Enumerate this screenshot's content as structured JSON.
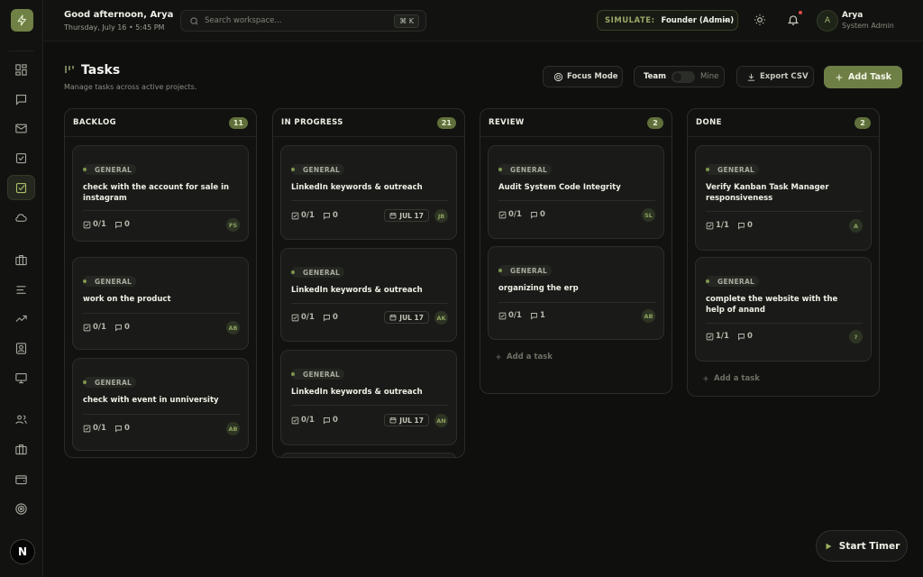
{
  "header": {
    "greeting": "Good afternoon, Arya",
    "datetime": "Thursday, July 16 • 5:45 PM",
    "search_placeholder": "Search workspace...",
    "search_shortcut": "⌘ K",
    "simulate_label": "SIMULATE:",
    "simulate_role": "Founder (Admin)",
    "user_initial": "A",
    "user_name": "Arya",
    "user_role": "System Admin"
  },
  "sidebar": {
    "logo_icon": "bolt-icon",
    "items": [
      {
        "icon": "dashboard-icon",
        "active": false
      },
      {
        "icon": "chat-icon",
        "active": false
      },
      {
        "icon": "mail-icon",
        "active": false
      },
      {
        "icon": "checkbox-icon",
        "active": false
      },
      {
        "icon": "tasks-icon",
        "active": true
      },
      {
        "icon": "cloud-icon",
        "active": false
      },
      {
        "icon": "briefcase-icon",
        "active": false
      },
      {
        "icon": "list-icon",
        "active": false
      },
      {
        "icon": "trending-icon",
        "active": false
      },
      {
        "icon": "contact-icon",
        "active": false
      },
      {
        "icon": "monitor-icon",
        "active": false
      },
      {
        "icon": "users-icon",
        "active": false
      },
      {
        "icon": "briefcase-icon",
        "active": false
      },
      {
        "icon": "wallet-icon",
        "active": false
      },
      {
        "icon": "target-icon",
        "active": false
      }
    ],
    "bottom_avatar": "N"
  },
  "page": {
    "title": "Tasks",
    "subtitle": "Manage tasks across active projects.",
    "focus_mode_label": "Focus Mode",
    "team_label": "Team",
    "mine_label": "Mine",
    "export_label": "Export CSV",
    "add_task_label": "Add Task"
  },
  "columns": [
    {
      "title": "BACKLOG",
      "count": "11",
      "cards": [
        {
          "tag": "GENERAL",
          "title": "check with the account for sale in instagram",
          "subtasks": "0/1",
          "comments": "0",
          "due": "",
          "assignee": "FS"
        },
        {
          "tag": "GENERAL",
          "title": "work on the product",
          "subtasks": "0/1",
          "comments": "0",
          "due": "",
          "assignee": "AB"
        },
        {
          "tag": "GENERAL",
          "title": "check with event in unniversity",
          "subtasks": "0/1",
          "comments": "0",
          "due": "",
          "assignee": "AB"
        }
      ],
      "add_task": ""
    },
    {
      "title": "IN PROGRESS",
      "count": "21",
      "cards": [
        {
          "tag": "GENERAL",
          "title": "LinkedIn keywords & outreach",
          "subtasks": "0/1",
          "comments": "0",
          "due": "JUL 17",
          "assignee": "JB"
        },
        {
          "tag": "GENERAL",
          "title": "LinkedIn keywords & outreach",
          "subtasks": "0/1",
          "comments": "0",
          "due": "JUL 17",
          "assignee": "AK"
        },
        {
          "tag": "GENERAL",
          "title": "LinkedIn keywords & outreach",
          "subtasks": "0/1",
          "comments": "0",
          "due": "JUL 17",
          "assignee": "AN"
        }
      ],
      "add_task": ""
    },
    {
      "title": "REVIEW",
      "count": "2",
      "cards": [
        {
          "tag": "GENERAL",
          "title": "Audit System Code Integrity",
          "subtasks": "0/1",
          "comments": "0",
          "due": "",
          "assignee": "SL"
        },
        {
          "tag": "GENERAL",
          "title": "organizing the erp",
          "subtasks": "0/1",
          "comments": "1",
          "due": "",
          "assignee": "AB"
        }
      ],
      "add_task": "Add a task"
    },
    {
      "title": "DONE",
      "count": "2",
      "cards": [
        {
          "tag": "GENERAL",
          "title": "Verify Kanban Task Manager responsiveness",
          "subtasks": "1/1",
          "comments": "0",
          "due": "",
          "assignee": "A"
        },
        {
          "tag": "GENERAL",
          "title": "complete the website with the help of anand",
          "subtasks": "1/1",
          "comments": "0",
          "due": "",
          "assignee": "?"
        }
      ],
      "add_task": "Add a task"
    }
  ],
  "timer": {
    "label": "Start Timer"
  },
  "colors": {
    "accent": "#6e7f45",
    "background": "#0f100e",
    "card": "#1a1b18",
    "notification": "#e04a4a"
  }
}
